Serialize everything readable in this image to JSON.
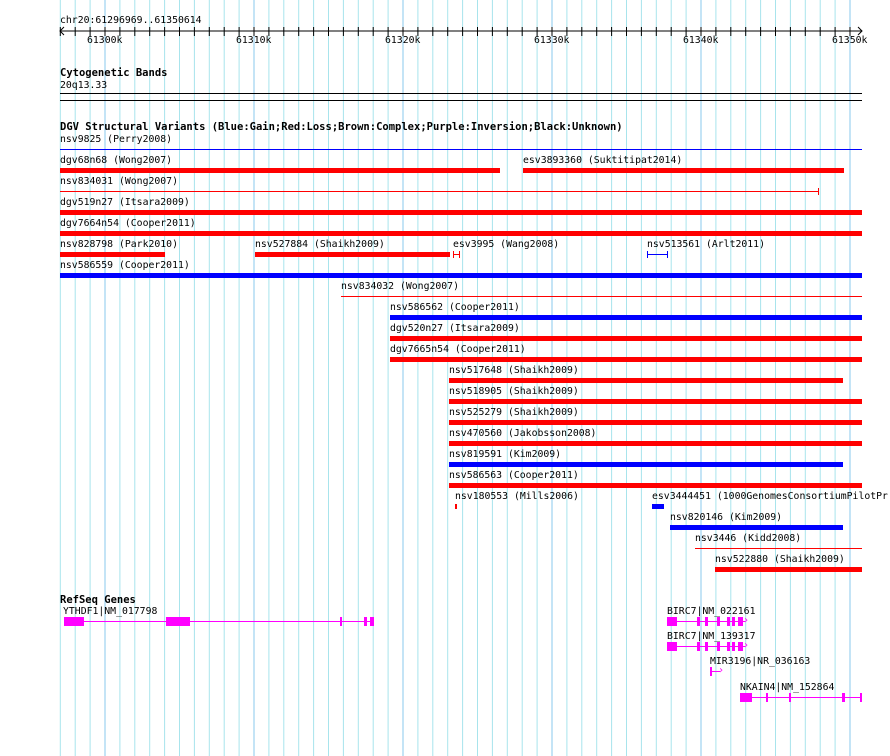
{
  "ruler": {
    "location": "chr20:61296969..61350614",
    "ticks": [
      "61300k",
      "61310k",
      "61320k",
      "61330k",
      "61340k",
      "61350k"
    ]
  },
  "cyto": {
    "title": "Cytogenetic Bands",
    "band": "20q13.33"
  },
  "dgv": {
    "title": "DGV Structural Variants (Blue:Gain;Red:Loss;Brown:Complex;Purple:Inversion;Black:Unknown)",
    "items": [
      "nsv9825 (Perry2008)",
      "dgv68n68 (Wong2007)",
      "esv3893360 (Suktitipat2014)",
      "nsv834031 (Wong2007)",
      "dgv519n27 (Itsara2009)",
      "dgv7664n54 (Cooper2011)",
      "nsv828798 (Park2010)",
      "nsv527884 (Shaikh2009)",
      "esv3995 (Wang2008)",
      "nsv513561 (Arlt2011)",
      "nsv586559 (Cooper2011)",
      "nsv834032 (Wong2007)",
      "nsv586562 (Cooper2011)",
      "dgv520n27 (Itsara2009)",
      "dgv7665n54 (Cooper2011)",
      "nsv517648 (Shaikh2009)",
      "nsv518905 (Shaikh2009)",
      "nsv525279 (Shaikh2009)",
      "nsv470560 (Jakobsson2008)",
      "nsv819591 (Kim2009)",
      "nsv586563 (Cooper2011)",
      "nsv180553 (Mills2006)",
      "esv3444451 (1000GenomesConsortiumPilotPr",
      "nsv820146 (Kim2009)",
      "nsv3446 (Kidd2008)",
      "nsv522880 (Shaikh2009)"
    ]
  },
  "genes": {
    "title": "RefSeq Genes",
    "items": [
      "YTHDF1|NM_017798",
      "BIRC7|NM_022161",
      "BIRC7|NM_139317",
      "MIR3196|NR_036163",
      "NKAIN4|NM_152864"
    ]
  },
  "colors": {
    "gain": "#0000ff",
    "loss": "#ff0000",
    "gene": "#ff00ff",
    "grid": "#a8e4ec"
  }
}
